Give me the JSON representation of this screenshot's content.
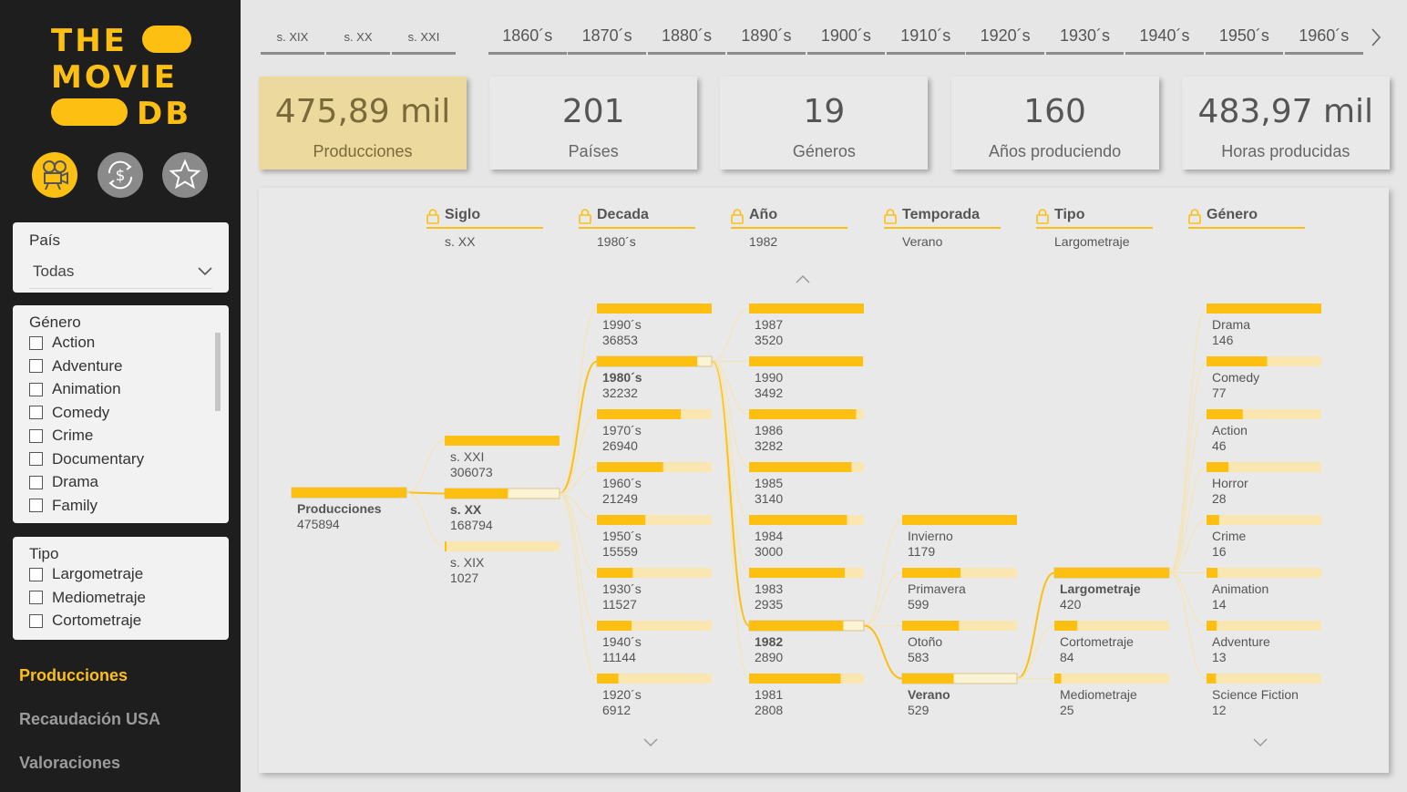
{
  "app": {
    "logo": {
      "line1": "THE",
      "line2": "MOVIE",
      "line3": "DB"
    },
    "nav_icons": [
      "film-projector-icon",
      "dollar-refresh-icon",
      "star-icon"
    ],
    "brand_color": "#fcbf12"
  },
  "filters": {
    "pais": {
      "label": "País",
      "value": "Todas"
    },
    "genero": {
      "label": "Género",
      "options": [
        "Action",
        "Adventure",
        "Animation",
        "Comedy",
        "Crime",
        "Documentary",
        "Drama",
        "Family"
      ]
    },
    "tipo": {
      "label": "Tipo",
      "options": [
        "Largometraje",
        "Mediometraje",
        "Cortometraje"
      ]
    }
  },
  "pages": [
    {
      "label": "Producciones",
      "active": true
    },
    {
      "label": "Recaudación USA",
      "active": false
    },
    {
      "label": "Valoraciones",
      "active": false
    }
  ],
  "timeline": {
    "centuries": [
      "s. XIX",
      "s. XX",
      "s. XXI"
    ],
    "decades": [
      "1860´s",
      "1870´s",
      "1880´s",
      "1890´s",
      "1900´s",
      "1910´s",
      "1920´s",
      "1930´s",
      "1940´s",
      "1950´s",
      "1960´s"
    ]
  },
  "kpis": [
    {
      "value": "475,89 mil",
      "label": "Producciones",
      "active": true
    },
    {
      "value": "201",
      "label": "Países",
      "active": false
    },
    {
      "value": "19",
      "label": "Géneros",
      "active": false
    },
    {
      "value": "160",
      "label": "Años produciendo",
      "active": false
    },
    {
      "value": "483,97 mil",
      "label": "Horas producidas",
      "active": false
    }
  ],
  "tree": {
    "levels": [
      {
        "name": "Siglo",
        "selected": "s. XX"
      },
      {
        "name": "Decada",
        "selected": "1980´s"
      },
      {
        "name": "Año",
        "selected": "1982"
      },
      {
        "name": "Temporada",
        "selected": "Verano"
      },
      {
        "name": "Tipo",
        "selected": "Largometraje"
      },
      {
        "name": "Género",
        "selected": ""
      }
    ],
    "root": {
      "label": "Producciones",
      "value": 475894
    },
    "columns": [
      {
        "selected_index": 1,
        "nodes": [
          {
            "label": "s. XXI",
            "value": 306073
          },
          {
            "label": "s. XX",
            "value": 168794
          },
          {
            "label": "s. XIX",
            "value": 1027
          }
        ]
      },
      {
        "selected_index": 1,
        "nodes": [
          {
            "label": "1990´s",
            "value": 36853
          },
          {
            "label": "1980´s",
            "value": 32232
          },
          {
            "label": "1970´s",
            "value": 26940
          },
          {
            "label": "1960´s",
            "value": 21249
          },
          {
            "label": "1950´s",
            "value": 15559
          },
          {
            "label": "1930´s",
            "value": 11527
          },
          {
            "label": "1940´s",
            "value": 11144
          },
          {
            "label": "1920´s",
            "value": 6912
          }
        ]
      },
      {
        "selected_index": 6,
        "nodes": [
          {
            "label": "1987",
            "value": 3520
          },
          {
            "label": "1990",
            "value": 3492
          },
          {
            "label": "1986",
            "value": 3282
          },
          {
            "label": "1985",
            "value": 3140
          },
          {
            "label": "1984",
            "value": 3000
          },
          {
            "label": "1983",
            "value": 2935
          },
          {
            "label": "1982",
            "value": 2890
          },
          {
            "label": "1981",
            "value": 2808
          }
        ]
      },
      {
        "selected_index": 3,
        "nodes": [
          {
            "label": "Invierno",
            "value": 1179
          },
          {
            "label": "Primavera",
            "value": 599
          },
          {
            "label": "Otoño",
            "value": 583
          },
          {
            "label": "Verano",
            "value": 529
          }
        ]
      },
      {
        "selected_index": 0,
        "nodes": [
          {
            "label": "Largometraje",
            "value": 420
          },
          {
            "label": "Cortometraje",
            "value": 84
          },
          {
            "label": "Mediometraje",
            "value": 25
          }
        ]
      },
      {
        "selected_index": -1,
        "nodes": [
          {
            "label": "Drama",
            "value": 146
          },
          {
            "label": "Comedy",
            "value": 77
          },
          {
            "label": "Action",
            "value": 46
          },
          {
            "label": "Horror",
            "value": 28
          },
          {
            "label": "Crime",
            "value": 16
          },
          {
            "label": "Animation",
            "value": 14
          },
          {
            "label": "Adventure",
            "value": 13
          },
          {
            "label": "Science Fiction",
            "value": 12
          }
        ]
      }
    ]
  }
}
